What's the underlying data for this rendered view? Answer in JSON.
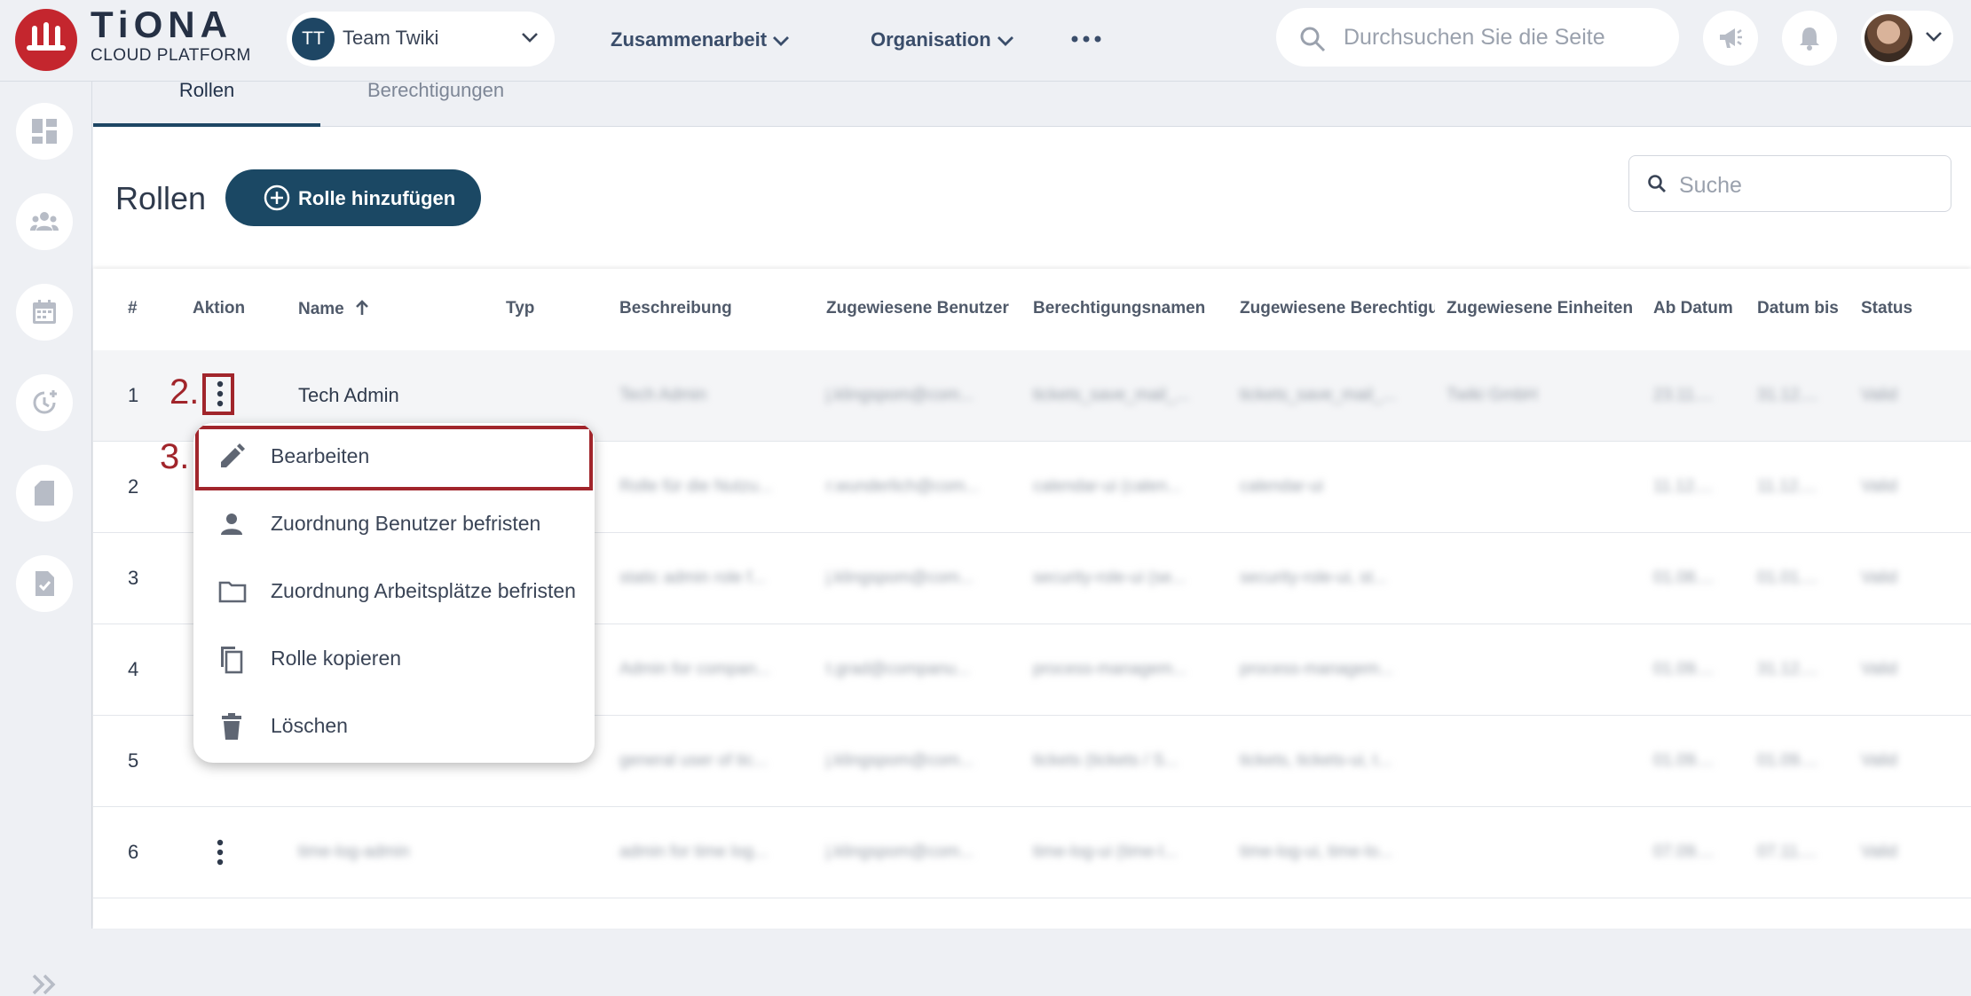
{
  "header": {
    "brand_name": "TiONA",
    "brand_sub": "CLOUD PLATFORM",
    "team_initials": "TT",
    "team_name": "Team Twiki",
    "nav": [
      "Zusammenarbeit",
      "Organisation"
    ],
    "search_placeholder": "Durchsuchen Sie die Seite"
  },
  "tabs": [
    "Rollen",
    "Berechtigungen"
  ],
  "page": {
    "title": "Rollen",
    "add_button": "Rolle hinzufügen",
    "search_placeholder": "Suche"
  },
  "table": {
    "columns": [
      "#",
      "Aktion",
      "Name",
      "Typ",
      "Beschreibung",
      "Zugewiesene Benutzer",
      "Berechtigungsnamen",
      "Zugewiesene Berechtigungen",
      "Zugewiesene Einheiten",
      "Ab Datum",
      "Datum bis",
      "Status"
    ],
    "rows": [
      {
        "num": "1",
        "name": "Tech Admin",
        "desc": "Tech Admin",
        "users": "j.klingspom@com...",
        "perms": "tickets_save_mail_...",
        "assigned": "tickets_save_mail_...",
        "units": "Twiki GmbH",
        "from": "23.11....",
        "to": "31.12....",
        "status": "Valid"
      },
      {
        "num": "2",
        "name": "",
        "desc": "Rolle für die Nutzu...",
        "users": "r.wunderlich@com...",
        "perms": "calendar-ui (calen...",
        "assigned": "calendar-ui",
        "units": "",
        "from": "11.12....",
        "to": "11.12....",
        "status": "Valid"
      },
      {
        "num": "3",
        "name": "",
        "desc": "static admin role f...",
        "users": "j.klingspom@com...",
        "perms": "security-role-ui (se...",
        "assigned": "security-role-ui, st...",
        "units": "",
        "from": "01.08....",
        "to": "01.01....",
        "status": "Valid"
      },
      {
        "num": "4",
        "name": "",
        "desc": "Admin for compan...",
        "users": "t.grad@companu...",
        "perms": "process-managem...",
        "assigned": "process-managem...",
        "units": "",
        "from": "01.09....",
        "to": "31.12....",
        "status": "Valid"
      },
      {
        "num": "5",
        "name": "",
        "desc": "general user of tic...",
        "users": "j.klingspom@com...",
        "perms": "tickets (tickets / S...",
        "assigned": "tickets, tickets-ui, t...",
        "units": "",
        "from": "01.09....",
        "to": "01.09....",
        "status": "Valid"
      },
      {
        "num": "6",
        "name": "time-log-admin",
        "desc": "admin for time log...",
        "users": "j.klingspom@com...",
        "perms": "time-log-ui (time-l...",
        "assigned": "time-log-ui, time-lo...",
        "units": "",
        "from": "07.09....",
        "to": "07.11....",
        "status": "Valid"
      }
    ]
  },
  "annotations": {
    "step2": "2.",
    "step3": "3."
  },
  "menu": {
    "items": [
      "Bearbeiten",
      "Zuordnung Benutzer befristen",
      "Zuordnung Arbeitsplätze befristen",
      "Rolle kopieren",
      "Löschen"
    ]
  },
  "colors": {
    "brand_red": "#c4262e",
    "primary": "#1b4864",
    "annotation": "#a1252b"
  }
}
